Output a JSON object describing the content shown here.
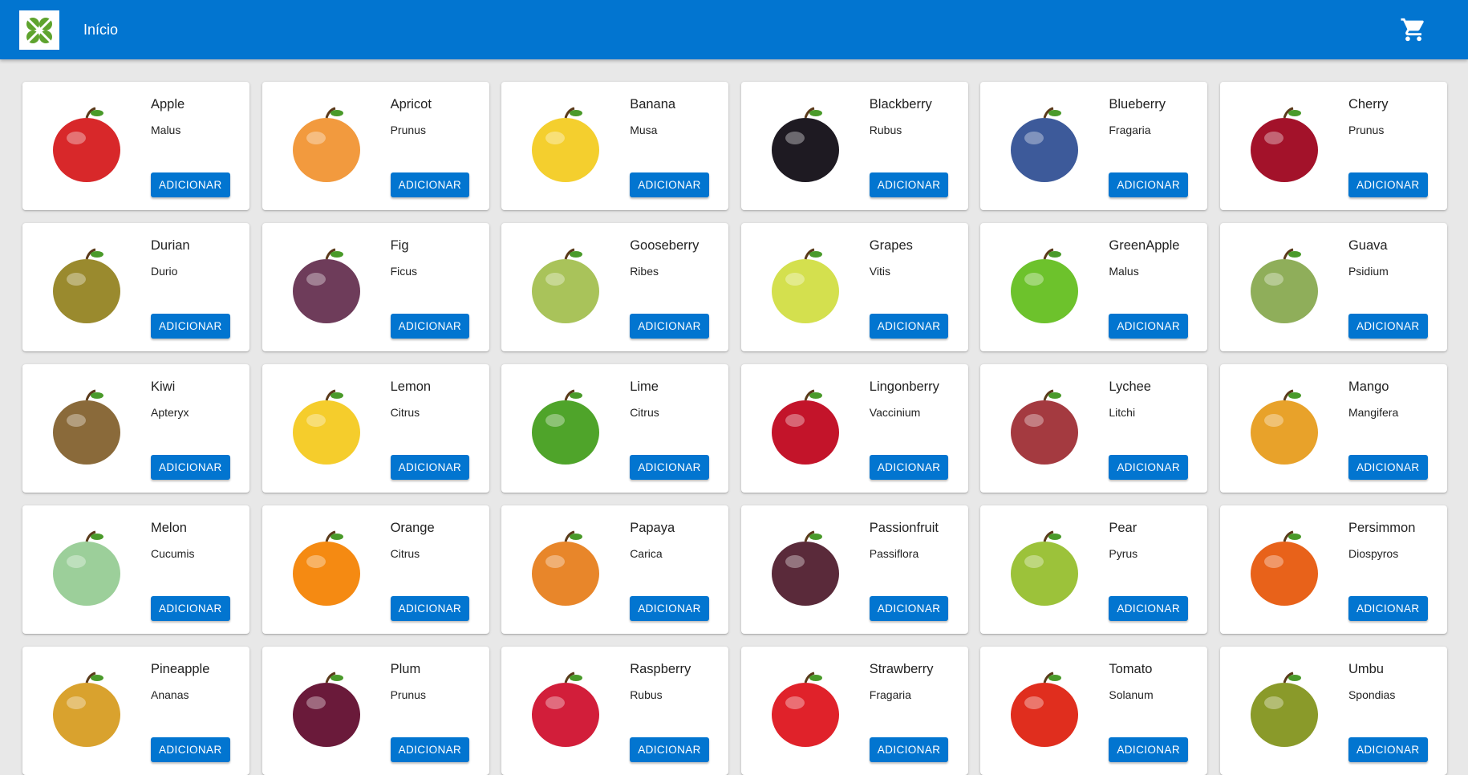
{
  "header": {
    "home_label": "Início",
    "cart_icon": "cart-icon",
    "logo_icon": "clover-logo-icon",
    "bar_color": "#0275d0"
  },
  "add_label": "ADICIONAR",
  "products": [
    {
      "name": "Apple",
      "genus": "Malus",
      "color": "#d8282a"
    },
    {
      "name": "Apricot",
      "genus": "Prunus",
      "color": "#f29a3e"
    },
    {
      "name": "Banana",
      "genus": "Musa",
      "color": "#f4cf2e"
    },
    {
      "name": "Blackberry",
      "genus": "Rubus",
      "color": "#1e1a22"
    },
    {
      "name": "Blueberry",
      "genus": "Fragaria",
      "color": "#3d5a9a"
    },
    {
      "name": "Cherry",
      "genus": "Prunus",
      "color": "#a3122a"
    },
    {
      "name": "Durian",
      "genus": "Durio",
      "color": "#9a8a2e"
    },
    {
      "name": "Fig",
      "genus": "Ficus",
      "color": "#6e3c5a"
    },
    {
      "name": "Gooseberry",
      "genus": "Ribes",
      "color": "#a9c35a"
    },
    {
      "name": "Grapes",
      "genus": "Vitis",
      "color": "#d4e04e"
    },
    {
      "name": "GreenApple",
      "genus": "Malus",
      "color": "#6dc22c"
    },
    {
      "name": "Guava",
      "genus": "Psidium",
      "color": "#8fae5a"
    },
    {
      "name": "Kiwi",
      "genus": "Apteryx",
      "color": "#8a6a3a"
    },
    {
      "name": "Lemon",
      "genus": "Citrus",
      "color": "#f5cd2c"
    },
    {
      "name": "Lime",
      "genus": "Citrus",
      "color": "#4fa42a"
    },
    {
      "name": "Lingonberry",
      "genus": "Vaccinium",
      "color": "#c3142a"
    },
    {
      "name": "Lychee",
      "genus": "Litchi",
      "color": "#a43a40"
    },
    {
      "name": "Mango",
      "genus": "Mangifera",
      "color": "#e8a22a"
    },
    {
      "name": "Melon",
      "genus": "Cucumis",
      "color": "#9ccf9a"
    },
    {
      "name": "Orange",
      "genus": "Citrus",
      "color": "#f58a12"
    },
    {
      "name": "Papaya",
      "genus": "Carica",
      "color": "#e8862a"
    },
    {
      "name": "Passionfruit",
      "genus": "Passiflora",
      "color": "#5a2a3a"
    },
    {
      "name": "Pear",
      "genus": "Pyrus",
      "color": "#9cc23a"
    },
    {
      "name": "Persimmon",
      "genus": "Diospyros",
      "color": "#e8621a"
    },
    {
      "name": "Pineapple",
      "genus": "Ananas",
      "color": "#d9a22e"
    },
    {
      "name": "Plum",
      "genus": "Prunus",
      "color": "#6a1a3a"
    },
    {
      "name": "Raspberry",
      "genus": "Rubus",
      "color": "#d21e3a"
    },
    {
      "name": "Strawberry",
      "genus": "Fragaria",
      "color": "#e0222a"
    },
    {
      "name": "Tomato",
      "genus": "Solanum",
      "color": "#e02e1e"
    },
    {
      "name": "Umbu",
      "genus": "Spondias",
      "color": "#8a9a2a"
    }
  ]
}
